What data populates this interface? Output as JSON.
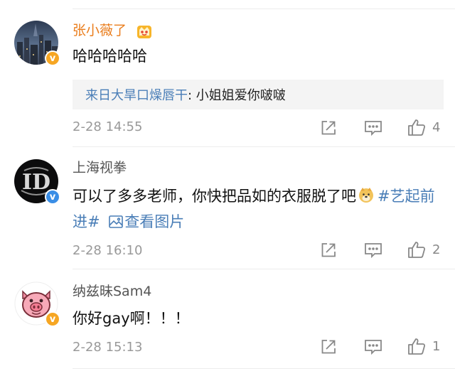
{
  "colors": {
    "username_member": "#ea7d1c",
    "link": "#4a7eb7",
    "time": "#999999",
    "verified_badge": "#f6a623",
    "reply_bg": "#f4f4f4"
  },
  "comments": [
    {
      "username": "张小薇了",
      "has_member_badge": true,
      "text": "哈哈哈哈哈",
      "reply": {
        "user": "来日大旱口燥唇干",
        "text": ": 小姐姐爱你啵啵"
      },
      "time": "2-28 14:55",
      "likes": "4",
      "avatar": "city-night-avatar"
    },
    {
      "username": "上海视拳",
      "text_main": "可以了多多老师，你快把品如的衣服脱了吧",
      "emoji": "doge-emoji",
      "hashtag": "#艺起前进#",
      "link_text": "查看图片",
      "time": "2-28 16:10",
      "likes": "2",
      "avatar": "dark-logo-avatar"
    },
    {
      "username": "纳兹昧Sam4",
      "text": "你好gay啊！！！",
      "time": "2-28 15:13",
      "likes": "1",
      "avatar": "pig-avatar"
    }
  ],
  "icons": {
    "share": "share-icon",
    "comment": "comment-icon",
    "like": "thumbs-up-icon",
    "image": "image-icon",
    "verified": "verified-badge-icon"
  }
}
